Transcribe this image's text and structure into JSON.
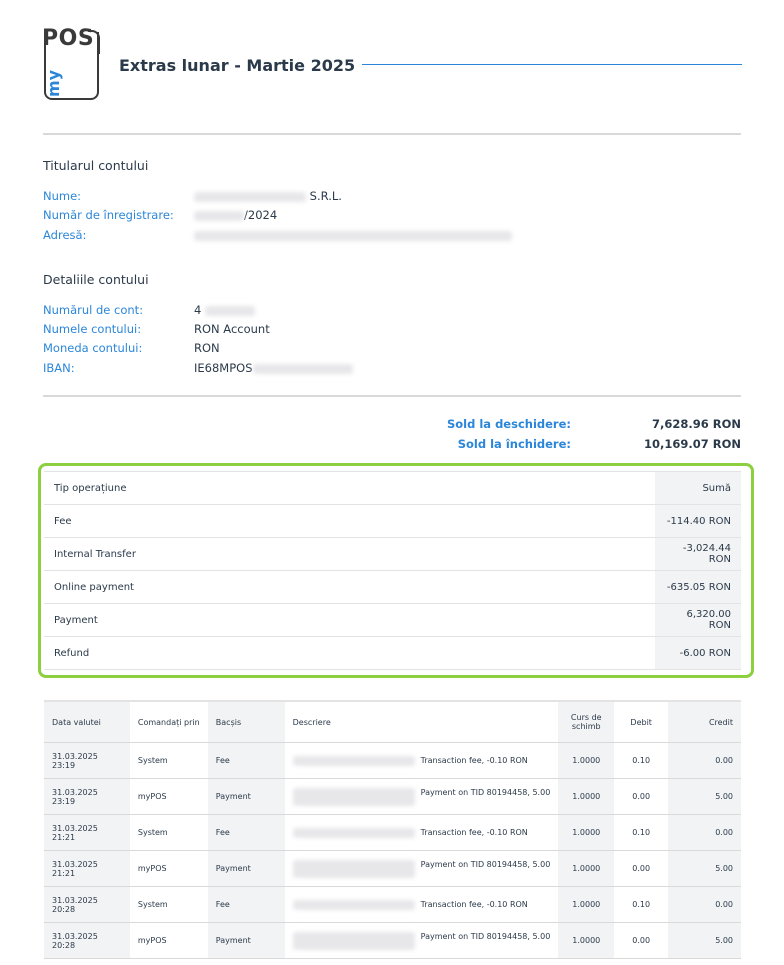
{
  "header": {
    "logo_top": "POS",
    "logo_side": "my",
    "title": "Extras lunar - Martie 2025"
  },
  "holder": {
    "heading": "Titularul contului",
    "rows": [
      {
        "label": "Nume:",
        "value": "S.R.L."
      },
      {
        "label": "Număr de înregistrare:",
        "value": "/2024"
      },
      {
        "label": "Adresă:",
        "value": ""
      }
    ]
  },
  "account": {
    "heading": "Detaliile contului",
    "rows": [
      {
        "label": "Numărul de cont:",
        "value": "4"
      },
      {
        "label": "Numele contului:",
        "value": "RON Account"
      },
      {
        "label": "Moneda contului:",
        "value": "RON"
      },
      {
        "label": "IBAN:",
        "value": "IE68MPOS"
      }
    ]
  },
  "balances": {
    "opening_label": "Sold la deschidere:",
    "opening_value": "7,628.96 RON",
    "closing_label": "Sold la închidere:",
    "closing_value": "10,169.07 RON"
  },
  "summary": {
    "col_type": "Tip operațiune",
    "col_amount": "Sumă",
    "rows": [
      {
        "type": "Fee",
        "amount": "-114.40 RON"
      },
      {
        "type": "Internal Transfer",
        "amount": "-3,024.44 RON"
      },
      {
        "type": "Online payment",
        "amount": "-635.05 RON"
      },
      {
        "type": "Payment",
        "amount": "6,320.00 RON"
      },
      {
        "type": "Refund",
        "amount": "-6.00 RON"
      }
    ]
  },
  "transactions": {
    "columns": {
      "date": "Data valutei",
      "ordered_by": "Comandați prin",
      "tip": "Bacșis",
      "description": "Descriere",
      "rate": "Curs de schimb",
      "debit": "Debit",
      "credit": "Credit"
    },
    "rows": [
      {
        "date": "31.03.2025 23:19",
        "by": "System",
        "type": "Fee",
        "desc": "Transaction fee, -0.10 RON",
        "rate": "1.0000",
        "debit": "0.10",
        "credit": "0.00"
      },
      {
        "date": "31.03.2025 23:19",
        "by": "myPOS",
        "type": "Payment",
        "desc": "Payment on TID 80194458, 5.00",
        "rate": "1.0000",
        "debit": "0.00",
        "credit": "5.00"
      },
      {
        "date": "31.03.2025 21:21",
        "by": "System",
        "type": "Fee",
        "desc": "Transaction fee, -0.10 RON",
        "rate": "1.0000",
        "debit": "0.10",
        "credit": "0.00"
      },
      {
        "date": "31.03.2025 21:21",
        "by": "myPOS",
        "type": "Payment",
        "desc": "Payment on TID 80194458, 5.00",
        "rate": "1.0000",
        "debit": "0.00",
        "credit": "5.00"
      },
      {
        "date": "31.03.2025 20:28",
        "by": "System",
        "type": "Fee",
        "desc": "Transaction fee, -0.10 RON",
        "rate": "1.0000",
        "debit": "0.10",
        "credit": "0.00"
      },
      {
        "date": "31.03.2025 20:28",
        "by": "myPOS",
        "type": "Payment",
        "desc": "Payment on TID 80194458, 5.00",
        "rate": "1.0000",
        "debit": "0.00",
        "credit": "5.00"
      }
    ]
  },
  "colors": {
    "accent": "#2b86d9",
    "highlight": "#8ccf3f"
  }
}
